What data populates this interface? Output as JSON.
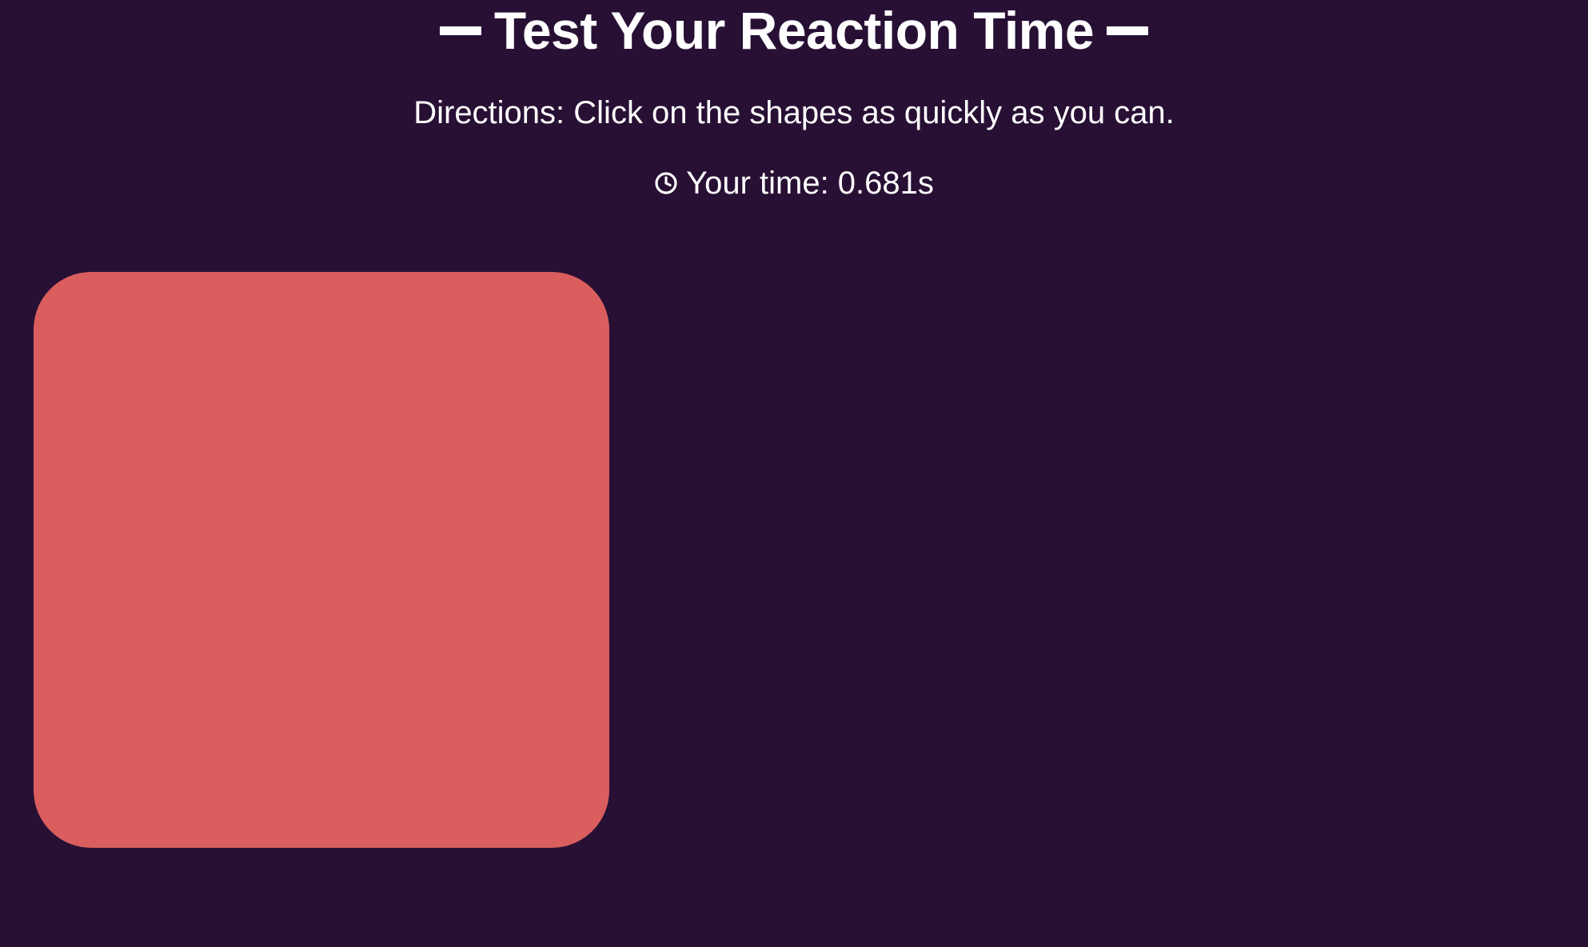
{
  "header": {
    "title": "Test Your Reaction Time",
    "directions": "Directions: Click on the shapes as quickly as you can.",
    "time_label": "Your time: 0.681s"
  },
  "icons": {
    "clock": "clock-icon",
    "left_dash": "dash-decoration",
    "right_dash": "dash-decoration"
  },
  "colors": {
    "background": "#281034",
    "shape": "#DA5E5E",
    "text": "#FFFFFF"
  },
  "shape": {
    "kind": "rounded-square"
  }
}
